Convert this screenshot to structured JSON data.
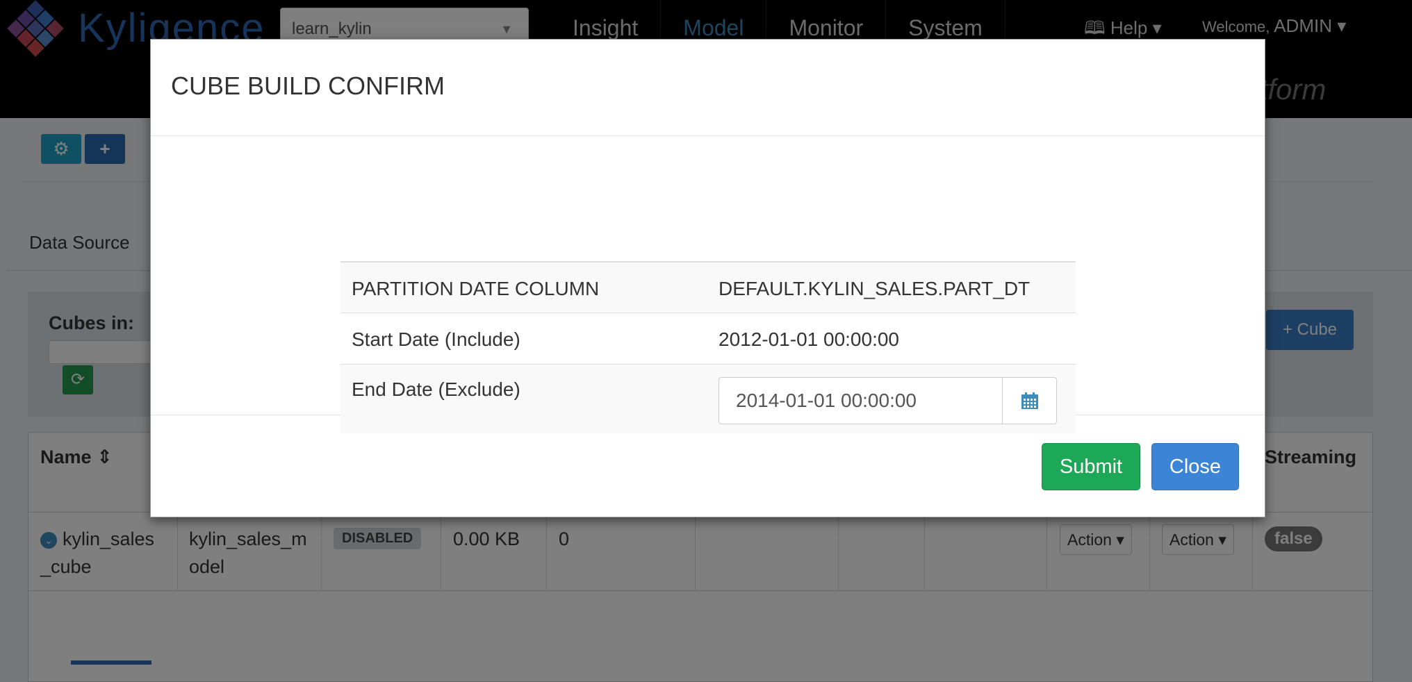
{
  "header": {
    "logo_text": "Kyligence",
    "project": "learn_kylin",
    "nav": [
      "Insight",
      "Model",
      "Monitor",
      "System"
    ],
    "active_nav": "Model",
    "help_label": "Help",
    "welcome_prefix": "Welcome,",
    "user": "ADMIN",
    "platform_text": "latform"
  },
  "page": {
    "tab_label": "Data Source",
    "cubes_in_label": "Cubes in:",
    "add_cube_label": "Cube"
  },
  "grid": {
    "headers": {
      "name": "Name",
      "streaming": "Streaming"
    },
    "row": {
      "name_line1": "kylin_sales",
      "name_line2": "_cube",
      "model_line1": "kylin_sales_m",
      "model_line2": "odel",
      "status": "DISABLED",
      "size": "0.00 KB",
      "source_records": "0",
      "action1": "Action",
      "action2": "Action",
      "streaming": "false"
    }
  },
  "modal": {
    "title": "CUBE BUILD CONFIRM",
    "rows": [
      {
        "label": "PARTITION DATE COLUMN",
        "value": "DEFAULT.KYLIN_SALES.PART_DT"
      },
      {
        "label": "Start Date (Include)",
        "value": "2012-01-01 00:00:00"
      },
      {
        "label": "End Date (Exclude)",
        "value": "2014-01-01 00:00:00"
      }
    ],
    "submit_label": "Submit",
    "close_label": "Close"
  }
}
